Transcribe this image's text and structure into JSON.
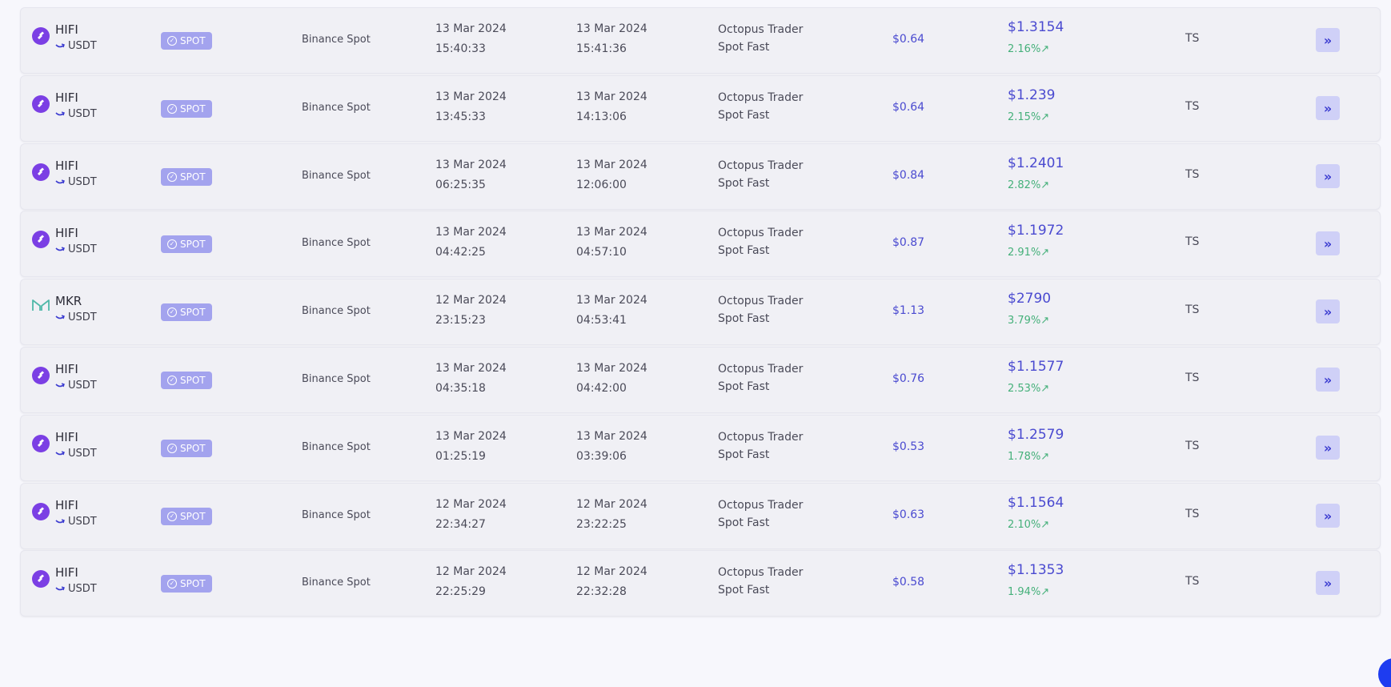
{
  "rows": [
    {
      "base": "HIFI",
      "quote": "USDT",
      "coin_icon": "hifi-coin-icon",
      "badge": "SPOT",
      "exchange": "Binance Spot",
      "open_date": "13 Mar 2024",
      "open_time": "15:40:33",
      "close_date": "13 Mar 2024",
      "close_time": "15:41:36",
      "bot_line1": "Octopus Trader",
      "bot_line2": "Spot Fast",
      "profit": "$0.64",
      "price": "$1.3154",
      "pct": "2.16%↗",
      "owner": "TS"
    },
    {
      "base": "HIFI",
      "quote": "USDT",
      "coin_icon": "hifi-coin-icon",
      "badge": "SPOT",
      "exchange": "Binance Spot",
      "open_date": "13 Mar 2024",
      "open_time": "13:45:33",
      "close_date": "13 Mar 2024",
      "close_time": "14:13:06",
      "bot_line1": "Octopus Trader",
      "bot_line2": "Spot Fast",
      "profit": "$0.64",
      "price": "$1.239",
      "pct": "2.15%↗",
      "owner": "TS"
    },
    {
      "base": "HIFI",
      "quote": "USDT",
      "coin_icon": "hifi-coin-icon",
      "badge": "SPOT",
      "exchange": "Binance Spot",
      "open_date": "13 Mar 2024",
      "open_time": "06:25:35",
      "close_date": "13 Mar 2024",
      "close_time": "12:06:00",
      "bot_line1": "Octopus Trader",
      "bot_line2": "Spot Fast",
      "profit": "$0.84",
      "price": "$1.2401",
      "pct": "2.82%↗",
      "owner": "TS"
    },
    {
      "base": "HIFI",
      "quote": "USDT",
      "coin_icon": "hifi-coin-icon",
      "badge": "SPOT",
      "exchange": "Binance Spot",
      "open_date": "13 Mar 2024",
      "open_time": "04:42:25",
      "close_date": "13 Mar 2024",
      "close_time": "04:57:10",
      "bot_line1": "Octopus Trader",
      "bot_line2": "Spot Fast",
      "profit": "$0.87",
      "price": "$1.1972",
      "pct": "2.91%↗",
      "owner": "TS"
    },
    {
      "base": "MKR",
      "quote": "USDT",
      "coin_icon": "mkr-coin-icon",
      "badge": "SPOT",
      "exchange": "Binance Spot",
      "open_date": "12 Mar 2024",
      "open_time": "23:15:23",
      "close_date": "13 Mar 2024",
      "close_time": "04:53:41",
      "bot_line1": "Octopus Trader",
      "bot_line2": "Spot Fast",
      "profit": "$1.13",
      "price": "$2790",
      "pct": "3.79%↗",
      "owner": "TS"
    },
    {
      "base": "HIFI",
      "quote": "USDT",
      "coin_icon": "hifi-coin-icon",
      "badge": "SPOT",
      "exchange": "Binance Spot",
      "open_date": "13 Mar 2024",
      "open_time": "04:35:18",
      "close_date": "13 Mar 2024",
      "close_time": "04:42:00",
      "bot_line1": "Octopus Trader",
      "bot_line2": "Spot Fast",
      "profit": "$0.76",
      "price": "$1.1577",
      "pct": "2.53%↗",
      "owner": "TS"
    },
    {
      "base": "HIFI",
      "quote": "USDT",
      "coin_icon": "hifi-coin-icon",
      "badge": "SPOT",
      "exchange": "Binance Spot",
      "open_date": "13 Mar 2024",
      "open_time": "01:25:19",
      "close_date": "13 Mar 2024",
      "close_time": "03:39:06",
      "bot_line1": "Octopus Trader",
      "bot_line2": "Spot Fast",
      "profit": "$0.53",
      "price": "$1.2579",
      "pct": "1.78%↗",
      "owner": "TS"
    },
    {
      "base": "HIFI",
      "quote": "USDT",
      "coin_icon": "hifi-coin-icon",
      "badge": "SPOT",
      "exchange": "Binance Spot",
      "open_date": "12 Mar 2024",
      "open_time": "22:34:27",
      "close_date": "12 Mar 2024",
      "close_time": "23:22:25",
      "bot_line1": "Octopus Trader",
      "bot_line2": "Spot Fast",
      "profit": "$0.63",
      "price": "$1.1564",
      "pct": "2.10%↗",
      "owner": "TS"
    },
    {
      "base": "HIFI",
      "quote": "USDT",
      "coin_icon": "hifi-coin-icon",
      "badge": "SPOT",
      "exchange": "Binance Spot",
      "open_date": "12 Mar 2024",
      "open_time": "22:25:29",
      "close_date": "12 Mar 2024",
      "close_time": "22:32:28",
      "bot_line1": "Octopus Trader",
      "bot_line2": "Spot Fast",
      "profit": "$0.58",
      "price": "$1.1353",
      "pct": "1.94%↗",
      "owner": "TS"
    }
  ],
  "action_icon": "double-chevron-right-icon",
  "colors": {
    "accent": "#4a4ad0",
    "positive": "#45b07a",
    "badge_bg": "#a3a3ee",
    "hifi_brand": "#7b3fe4",
    "mkr_brand": "#4fb8a8"
  }
}
